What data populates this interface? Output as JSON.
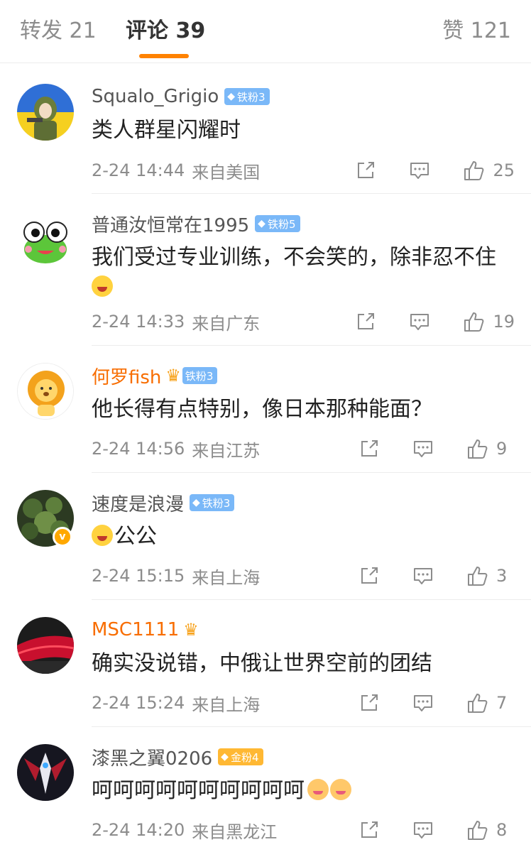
{
  "tabs": {
    "reposts": "转发 21",
    "comments": "评论 39",
    "likes": "赞 121",
    "active": "comments",
    "accent_color": "#ff8200"
  },
  "comments": [
    {
      "username": "Squalo_Grigio",
      "badge": "铁粉3",
      "text": "类人群星闪耀时",
      "time": "2-24 14:44",
      "location": "来自美国",
      "likes": "25"
    },
    {
      "username": "普通汝恒常在1995",
      "badge": "铁粉5",
      "text": "我们受过专业训练，不会笑的，除非忍不住",
      "time": "2-24 14:33",
      "location": "来自广东",
      "likes": "19"
    },
    {
      "username": "何罗fish",
      "badge": "铁粉3",
      "text": "他长得有点特别，像日本那种能面？",
      "time": "2-24 14:56",
      "location": "来自江苏",
      "likes": "9"
    },
    {
      "username": "速度是浪漫",
      "badge": "铁粉3",
      "text": "公公",
      "time": "2-24 15:15",
      "location": "来自上海",
      "likes": "3"
    },
    {
      "username": "MSC1111",
      "badge": "",
      "text": "确实没说错，中俄让世界空前的团结",
      "time": "2-24 15:24",
      "location": "来自上海",
      "likes": "7"
    },
    {
      "username": "漆黑之翼0206",
      "badge": "金粉4",
      "text": "呵呵呵呵呵呵呵呵呵呵",
      "time": "2-24 14:20",
      "location": "来自黑龙江",
      "likes": "8"
    }
  ]
}
